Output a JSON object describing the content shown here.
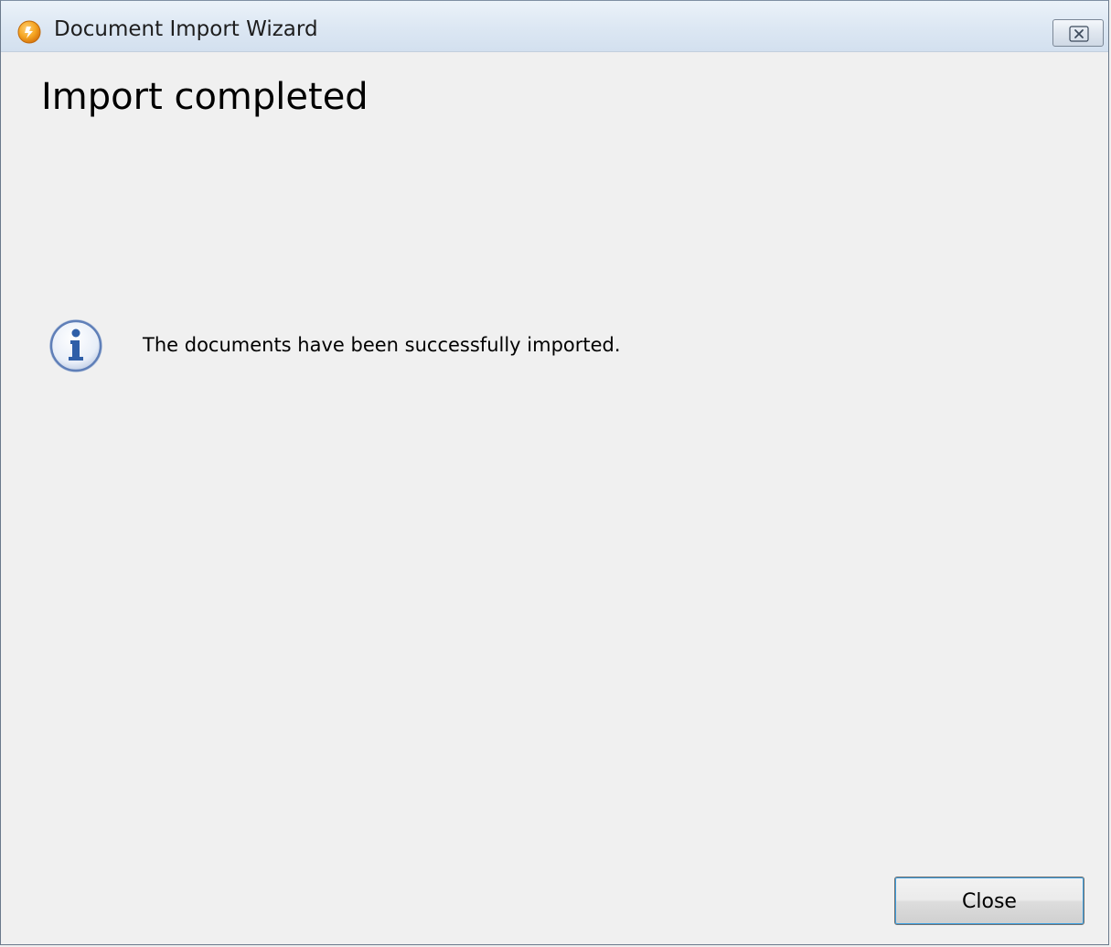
{
  "window": {
    "title": "Document Import Wizard",
    "icon": "app-logo-icon",
    "close_icon": "close-icon"
  },
  "page": {
    "heading": "Import completed",
    "message_icon": "info-icon",
    "message": "The documents have been successfully imported."
  },
  "buttons": {
    "close_label": "Close"
  },
  "colors": {
    "app_icon_orange": "#f5a623",
    "info_icon_blue": "#2f5fa8",
    "titlebar": "#dce7f3",
    "background": "#f0f0f0"
  }
}
